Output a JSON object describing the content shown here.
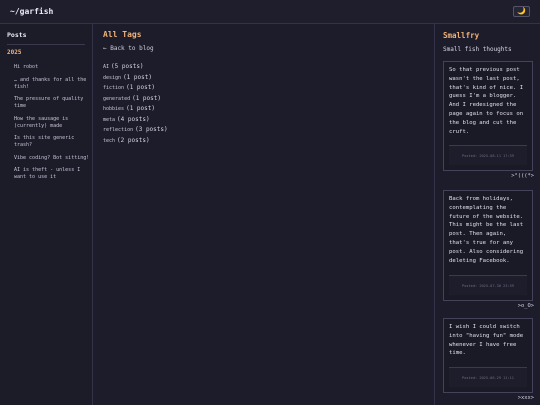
{
  "header": {
    "title": "~/garfish",
    "theme_icon": "moon-icon",
    "theme_glyph": "🌙"
  },
  "sidebar": {
    "heading": "Posts",
    "year": "2025",
    "items": [
      {
        "label": "Hi robot"
      },
      {
        "label": "… and thanks for all the fish!"
      },
      {
        "label": "The pressure of quality time"
      },
      {
        "label": "How the sausage is (currently) made"
      },
      {
        "label": "Is this site generic trash?"
      },
      {
        "label": "Vibe coding? Bot sitting!"
      },
      {
        "label": "AI is theft - unless I want to use it"
      }
    ]
  },
  "main": {
    "title": "All Tags",
    "back_link": "← Back to blog",
    "tags": [
      {
        "name": "AI",
        "count": "(5 posts)"
      },
      {
        "name": "design",
        "count": "(1 post)"
      },
      {
        "name": "fiction",
        "count": "(1 post)"
      },
      {
        "name": "generated",
        "count": "(1 post)"
      },
      {
        "name": "hobbies",
        "count": "(1 post)"
      },
      {
        "name": "meta",
        "count": "(4 posts)"
      },
      {
        "name": "reflection",
        "count": "(3 posts)"
      },
      {
        "name": "tech",
        "count": "(2 posts)"
      }
    ]
  },
  "smallfry": {
    "title": "Smallfry",
    "subtitle": "Small fish thoughts",
    "posts": [
      {
        "text": "So that previous post wasn't the last post, that's kind of nice. I guess I'm a blogger. And I redesigned the page again to focus on the blog and cut the cruft.",
        "posted": "Posted: 2025-08-11 17:59",
        "fish": ">°(((*>"
      },
      {
        "text": "Back from holidays, contemplating the future of the website. This might be the last post. Then again, that's true for any post. Also considering deleting Facebook.",
        "posted": "Posted: 2025-07-30 23:59",
        "fish": ">o_O>"
      },
      {
        "text": "I wish I could switch into \"having fun\" mode whenever I have free time.",
        "posted": "Posted: 2025-06-29 11:11",
        "fish": ">xxx>"
      }
    ]
  },
  "colors": {
    "accent": "#f0b37a",
    "background": "#1d1c2a",
    "border": "#34324a"
  }
}
